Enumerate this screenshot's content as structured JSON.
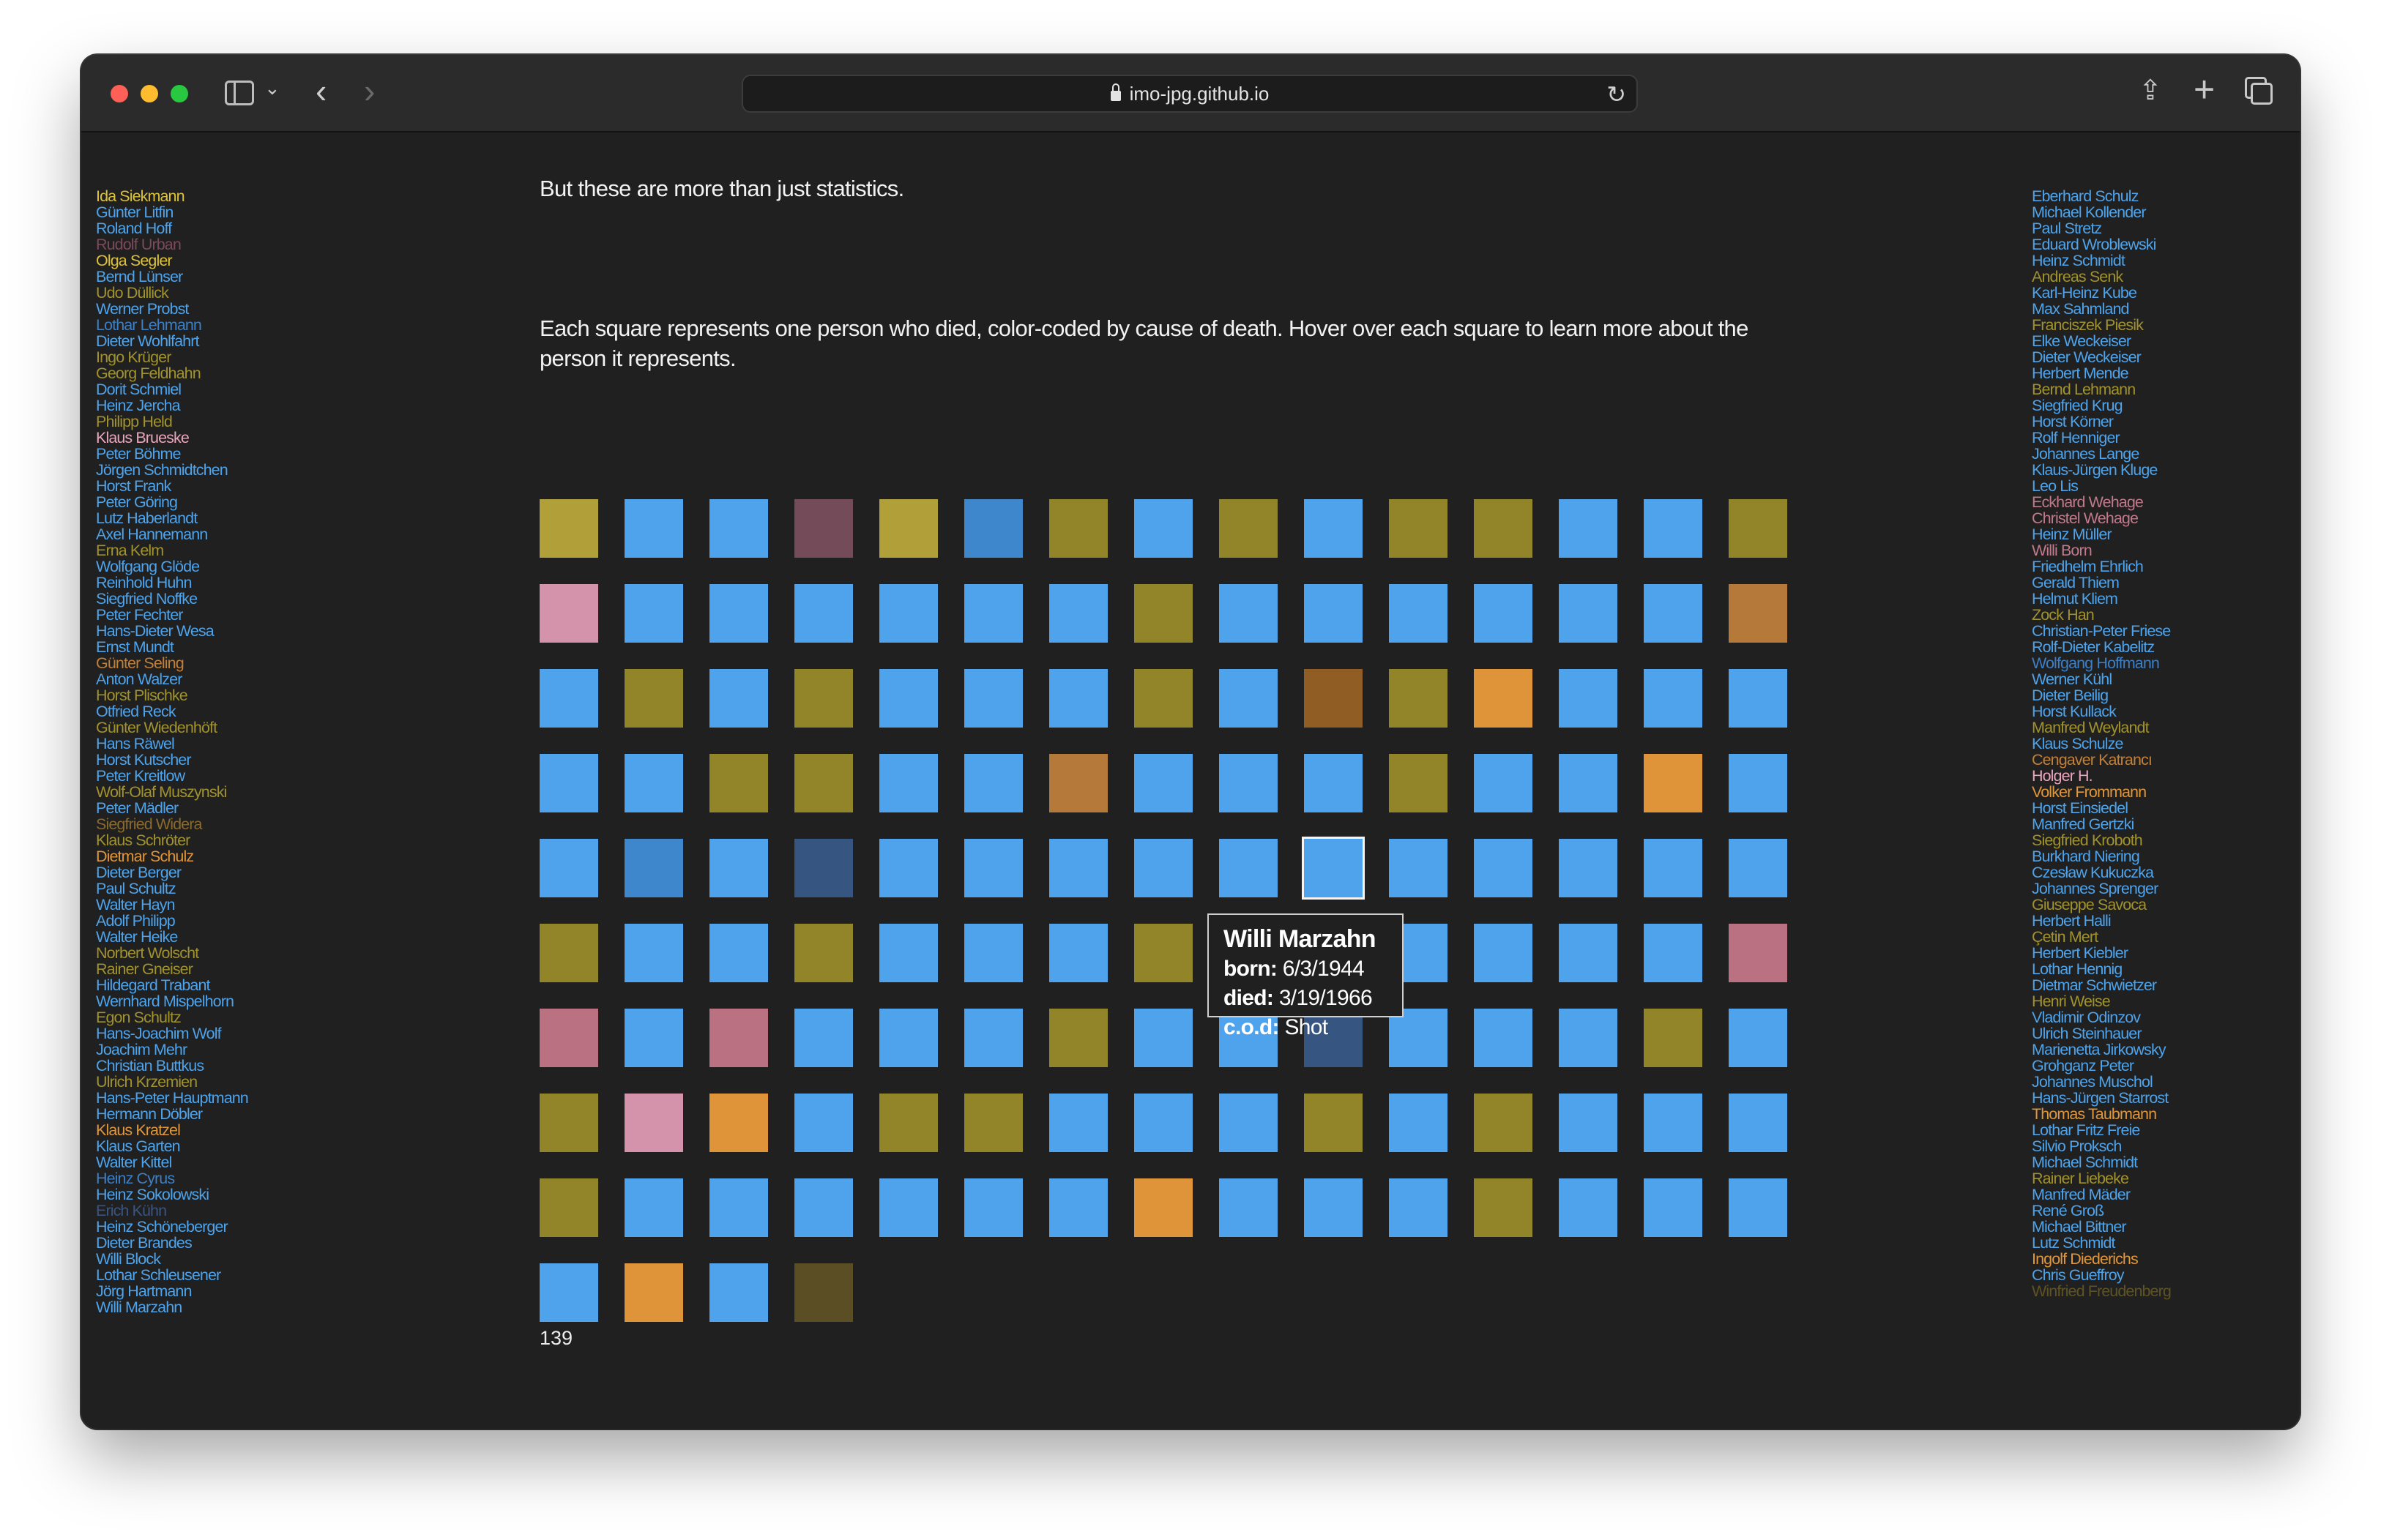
{
  "browser": {
    "url": "imo-jpg.github.io"
  },
  "intro": {
    "line1": "But these are more than just statistics.",
    "line2": "Each square represents one person who died, color-coded by cause of death. Hover over each square to learn more about the person it represents."
  },
  "left_names": [
    {
      "name": "Ida Siekmann",
      "color": "#dcc23a"
    },
    {
      "name": "Günter Litfin",
      "color": "#4ea3ea"
    },
    {
      "name": "Roland Hoff",
      "color": "#4ea3ea"
    },
    {
      "name": "Rudolf Urban",
      "color": "#7a4a5a"
    },
    {
      "name": "Olga Segler",
      "color": "#dcc23a"
    },
    {
      "name": "Bernd Lünser",
      "color": "#4ea3ea"
    },
    {
      "name": "Udo Düllick",
      "color": "#a0922e"
    },
    {
      "name": "Werner Probst",
      "color": "#4ea3ea"
    },
    {
      "name": "Lothar Lehmann",
      "color": "#3d7fc4"
    },
    {
      "name": "Dieter Wohlfahrt",
      "color": "#4ea3ea"
    },
    {
      "name": "Ingo Krüger",
      "color": "#a0922e"
    },
    {
      "name": "Georg Feldhahn",
      "color": "#a0922e"
    },
    {
      "name": "Dorit Schmiel",
      "color": "#4ea3ea"
    },
    {
      "name": "Heinz Jercha",
      "color": "#4ea3ea"
    },
    {
      "name": "Philipp Held",
      "color": "#a0922e"
    },
    {
      "name": "Klaus Brueske",
      "color": "#e8a6bd"
    },
    {
      "name": "Peter Böhme",
      "color": "#4ea3ea"
    },
    {
      "name": "Jörgen Schmidtchen",
      "color": "#4ea3ea"
    },
    {
      "name": "Horst Frank",
      "color": "#4ea3ea"
    },
    {
      "name": "Peter Göring",
      "color": "#4ea3ea"
    },
    {
      "name": "Lutz Haberlandt",
      "color": "#4ea3ea"
    },
    {
      "name": "Axel Hannemann",
      "color": "#4ea3ea"
    },
    {
      "name": "Erna Kelm",
      "color": "#a0922e"
    },
    {
      "name": "Wolfgang Glöde",
      "color": "#4ea3ea"
    },
    {
      "name": "Reinhold Huhn",
      "color": "#4ea3ea"
    },
    {
      "name": "Siegfried Noffke",
      "color": "#4ea3ea"
    },
    {
      "name": "Peter Fechter",
      "color": "#4ea3ea"
    },
    {
      "name": "Hans-Dieter Wesa",
      "color": "#4ea3ea"
    },
    {
      "name": "Ernst Mundt",
      "color": "#4ea3ea"
    },
    {
      "name": "Günter Seling",
      "color": "#c0803a"
    },
    {
      "name": "Anton Walzer",
      "color": "#4ea3ea"
    },
    {
      "name": "Horst Plischke",
      "color": "#a0922e"
    },
    {
      "name": "Otfried Reck",
      "color": "#4ea3ea"
    },
    {
      "name": "Günter Wiedenhöft",
      "color": "#a0922e"
    },
    {
      "name": "Hans Räwel",
      "color": "#4ea3ea"
    },
    {
      "name": "Horst Kutscher",
      "color": "#4ea3ea"
    },
    {
      "name": "Peter Kreitlow",
      "color": "#4ea3ea"
    },
    {
      "name": "Wolf-Olaf Muszynski",
      "color": "#a0922e"
    },
    {
      "name": "Peter Mädler",
      "color": "#4ea3ea"
    },
    {
      "name": "Siegfried Widera",
      "color": "#8a6a2e"
    },
    {
      "name": "Klaus Schröter",
      "color": "#a0922e"
    },
    {
      "name": "Dietmar Schulz",
      "color": "#e0963a"
    },
    {
      "name": "Dieter Berger",
      "color": "#4ea3ea"
    },
    {
      "name": "Paul Schultz",
      "color": "#4ea3ea"
    },
    {
      "name": "Walter Hayn",
      "color": "#4ea3ea"
    },
    {
      "name": "Adolf Philipp",
      "color": "#4ea3ea"
    },
    {
      "name": "Walter Heike",
      "color": "#4ea3ea"
    },
    {
      "name": "Norbert Wolscht",
      "color": "#a0922e"
    },
    {
      "name": "Rainer Gneiser",
      "color": "#a0922e"
    },
    {
      "name": "Hildegard Trabant",
      "color": "#4ea3ea"
    },
    {
      "name": "Wernhard Mispelhorn",
      "color": "#4ea3ea"
    },
    {
      "name": "Egon Schultz",
      "color": "#a0922e"
    },
    {
      "name": "Hans-Joachim Wolf",
      "color": "#4ea3ea"
    },
    {
      "name": "Joachim Mehr",
      "color": "#4ea3ea"
    },
    {
      "name": "Christian Buttkus",
      "color": "#4ea3ea"
    },
    {
      "name": "Ulrich Krzemien",
      "color": "#a0922e"
    },
    {
      "name": "Hans-Peter Hauptmann",
      "color": "#4ea3ea"
    },
    {
      "name": "Hermann Döbler",
      "color": "#4ea3ea"
    },
    {
      "name": "Klaus Kratzel",
      "color": "#e0963a"
    },
    {
      "name": "Klaus Garten",
      "color": "#4ea3ea"
    },
    {
      "name": "Walter Kittel",
      "color": "#4ea3ea"
    },
    {
      "name": "Heinz Cyrus",
      "color": "#3d7fc4"
    },
    {
      "name": "Heinz Sokolowski",
      "color": "#4ea3ea"
    },
    {
      "name": "Erich Kühn",
      "color": "#3a5480"
    },
    {
      "name": "Heinz Schöneberger",
      "color": "#4ea3ea"
    },
    {
      "name": "Dieter Brandes",
      "color": "#4ea3ea"
    },
    {
      "name": "Willi Block",
      "color": "#4ea3ea"
    },
    {
      "name": "Lothar Schleusener",
      "color": "#4ea3ea"
    },
    {
      "name": "Jörg Hartmann",
      "color": "#4ea3ea"
    },
    {
      "name": "Willi Marzahn",
      "color": "#4ea3ea"
    }
  ],
  "right_names": [
    {
      "name": "Eberhard Schulz",
      "color": "#4ea3ea"
    },
    {
      "name": "Michael Kollender",
      "color": "#4ea3ea"
    },
    {
      "name": "Paul Stretz",
      "color": "#4ea3ea"
    },
    {
      "name": "Eduard Wroblewski",
      "color": "#4ea3ea"
    },
    {
      "name": "Heinz Schmidt",
      "color": "#4ea3ea"
    },
    {
      "name": "Andreas Senk",
      "color": "#a0922e"
    },
    {
      "name": "Karl-Heinz Kube",
      "color": "#4ea3ea"
    },
    {
      "name": "Max Sahmland",
      "color": "#4ea3ea"
    },
    {
      "name": "Franciszek Piesik",
      "color": "#a0922e"
    },
    {
      "name": "Elke Weckeiser",
      "color": "#4ea3ea"
    },
    {
      "name": "Dieter Weckeiser",
      "color": "#4ea3ea"
    },
    {
      "name": "Herbert Mende",
      "color": "#4ea3ea"
    },
    {
      "name": "Bernd Lehmann",
      "color": "#a0922e"
    },
    {
      "name": "Siegfried Krug",
      "color": "#4ea3ea"
    },
    {
      "name": "Horst Körner",
      "color": "#4ea3ea"
    },
    {
      "name": "Rolf Henniger",
      "color": "#4ea3ea"
    },
    {
      "name": "Johannes Lange",
      "color": "#4ea3ea"
    },
    {
      "name": "Klaus-Jürgen Kluge",
      "color": "#4ea3ea"
    },
    {
      "name": "Leo Lis",
      "color": "#4ea3ea"
    },
    {
      "name": "Eckhard Wehage",
      "color": "#c07a8c"
    },
    {
      "name": "Christel Wehage",
      "color": "#c07a8c"
    },
    {
      "name": "Heinz Müller",
      "color": "#4ea3ea"
    },
    {
      "name": "Willi Born",
      "color": "#c07a8c"
    },
    {
      "name": "Friedhelm Ehrlich",
      "color": "#4ea3ea"
    },
    {
      "name": "Gerald Thiem",
      "color": "#4ea3ea"
    },
    {
      "name": "Helmut Kliem",
      "color": "#4ea3ea"
    },
    {
      "name": "Zock Han",
      "color": "#a0922e"
    },
    {
      "name": "Christian-Peter Friese",
      "color": "#4ea3ea"
    },
    {
      "name": "Rolf-Dieter Kabelitz",
      "color": "#4ea3ea"
    },
    {
      "name": "Wolfgang Hoffmann",
      "color": "#3d7fc4"
    },
    {
      "name": "Werner Kühl",
      "color": "#4ea3ea"
    },
    {
      "name": "Dieter Beilig",
      "color": "#4ea3ea"
    },
    {
      "name": "Horst Kullack",
      "color": "#4ea3ea"
    },
    {
      "name": "Manfred Weylandt",
      "color": "#a0922e"
    },
    {
      "name": "Klaus Schulze",
      "color": "#4ea3ea"
    },
    {
      "name": "Cengaver Katrancı",
      "color": "#c0803a"
    },
    {
      "name": "Holger H.",
      "color": "#e8a6bd"
    },
    {
      "name": "Volker Frommann",
      "color": "#e0963a"
    },
    {
      "name": "Horst Einsiedel",
      "color": "#4ea3ea"
    },
    {
      "name": "Manfred Gertzki",
      "color": "#4ea3ea"
    },
    {
      "name": "Siegfried Kroboth",
      "color": "#a0922e"
    },
    {
      "name": "Burkhard Niering",
      "color": "#4ea3ea"
    },
    {
      "name": "Czesław Kukuczka",
      "color": "#4ea3ea"
    },
    {
      "name": "Johannes Sprenger",
      "color": "#4ea3ea"
    },
    {
      "name": "Giuseppe Savoca",
      "color": "#a0922e"
    },
    {
      "name": "Herbert Halli",
      "color": "#4ea3ea"
    },
    {
      "name": "Çetin Mert",
      "color": "#a0922e"
    },
    {
      "name": "Herbert Kiebler",
      "color": "#4ea3ea"
    },
    {
      "name": "Lothar Hennig",
      "color": "#4ea3ea"
    },
    {
      "name": "Dietmar Schwietzer",
      "color": "#4ea3ea"
    },
    {
      "name": "Henri Weise",
      "color": "#a0922e"
    },
    {
      "name": "Vladimir Odinzov",
      "color": "#4ea3ea"
    },
    {
      "name": "Ulrich Steinhauer",
      "color": "#4ea3ea"
    },
    {
      "name": "Marienetta Jirkowsky",
      "color": "#4ea3ea"
    },
    {
      "name": "Grohganz Peter",
      "color": "#4ea3ea"
    },
    {
      "name": "Johannes Muschol",
      "color": "#4ea3ea"
    },
    {
      "name": "Hans-Jürgen Starrost",
      "color": "#4ea3ea"
    },
    {
      "name": "Thomas Taubmann",
      "color": "#e0963a"
    },
    {
      "name": "Lothar Fritz Freie",
      "color": "#4ea3ea"
    },
    {
      "name": "Silvio Proksch",
      "color": "#4ea3ea"
    },
    {
      "name": "Michael Schmidt",
      "color": "#4ea3ea"
    },
    {
      "name": "Rainer Liebeke",
      "color": "#a0922e"
    },
    {
      "name": "Manfred Mäder",
      "color": "#4ea3ea"
    },
    {
      "name": "René Groß",
      "color": "#4ea3ea"
    },
    {
      "name": "Michael Bittner",
      "color": "#4ea3ea"
    },
    {
      "name": "Lutz Schmidt",
      "color": "#4ea3ea"
    },
    {
      "name": "Ingolf Diederichs",
      "color": "#e0963a"
    },
    {
      "name": "Chris Gueffroy",
      "color": "#4ea3ea"
    },
    {
      "name": "Winfried Freudenberg",
      "color": "#5e5326"
    }
  ],
  "palette": {
    "A": "#b1a03a",
    "B": "#4fa3ec",
    "C": "#744b59",
    "D": "#3f87cc",
    "E": "#928428",
    "F": "#d593ab",
    "G": "#b57a3a",
    "H": "#905e24",
    "I": "#e0943a",
    "J": "#365580",
    "K": "#ba7283",
    "L": "#5b4e24"
  },
  "grid": [
    "ABBCADEBEBEEBBE",
    "FBBBBBBEBBBBBBG",
    "BEBEBBBEBHEIBBB",
    "BBEEBBGBBBEBBIB",
    "BDBJBBBBBBBBBBB",
    "EBBEBBBEBBBBBBK",
    "KBKBBBEBBJBBBEB",
    "EFIBEEBBBEBEBBB",
    "EBBBBBBIBBBEBBB",
    "BIBL"
  ],
  "selected_square": {
    "row": 4,
    "col": 9
  },
  "count": "139",
  "tooltip": {
    "name": "Willi Marzahn",
    "born_label": "born:",
    "born": "6/3/1944",
    "died_label": "died:",
    "died": "3/19/1966",
    "cod_label": "c.o.d:",
    "cod": "Shot"
  }
}
